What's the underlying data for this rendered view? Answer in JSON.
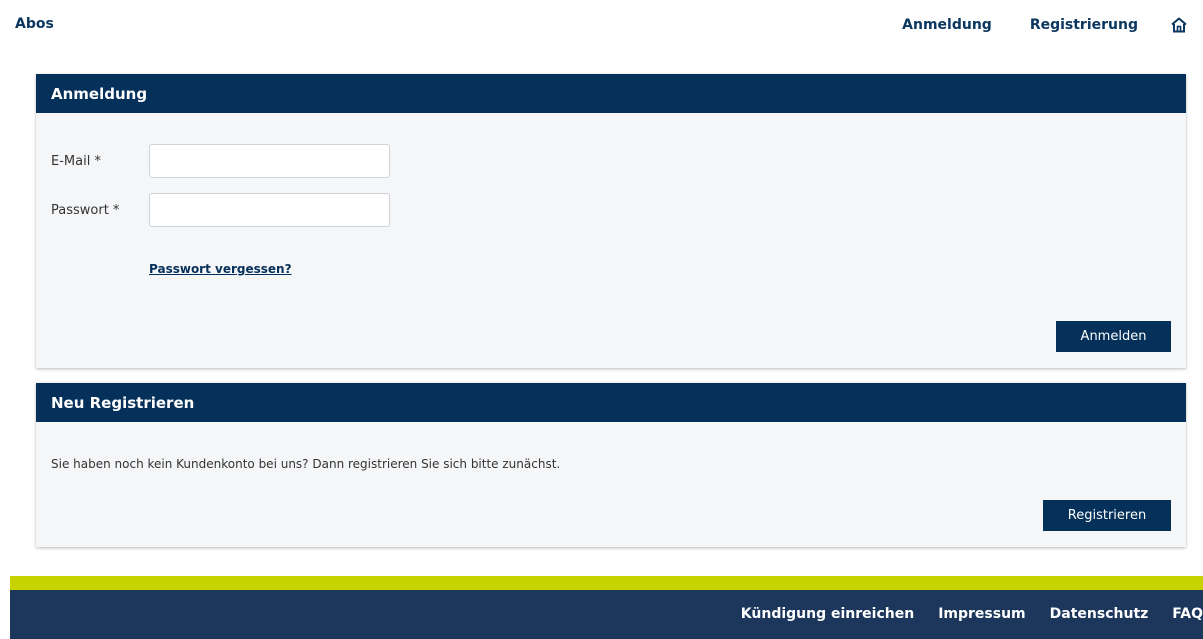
{
  "topnav": {
    "brand": "Abos",
    "links": [
      "Anmeldung",
      "Registrierung"
    ],
    "home_icon": "home-icon"
  },
  "login": {
    "title": "Anmeldung",
    "email_label": "E-Mail *",
    "email_value": "",
    "password_label": "Passwort *",
    "password_value": "",
    "forgot_link": "Passwort vergessen?",
    "submit_label": "Anmelden"
  },
  "register": {
    "title": "Neu Registrieren",
    "text": "Sie haben noch kein Kundenkonto bei uns? Dann registrieren Sie sich bitte zunächst.",
    "submit_label": "Registrieren"
  },
  "footer": {
    "links": [
      "Kündigung einreichen",
      "Impressum",
      "Datenschutz",
      "FAQ"
    ]
  },
  "colors": {
    "primary": "#05305a",
    "accent": "#c7d300",
    "footer_bg": "#1d375c",
    "panel_bg": "#f5f6f8"
  }
}
